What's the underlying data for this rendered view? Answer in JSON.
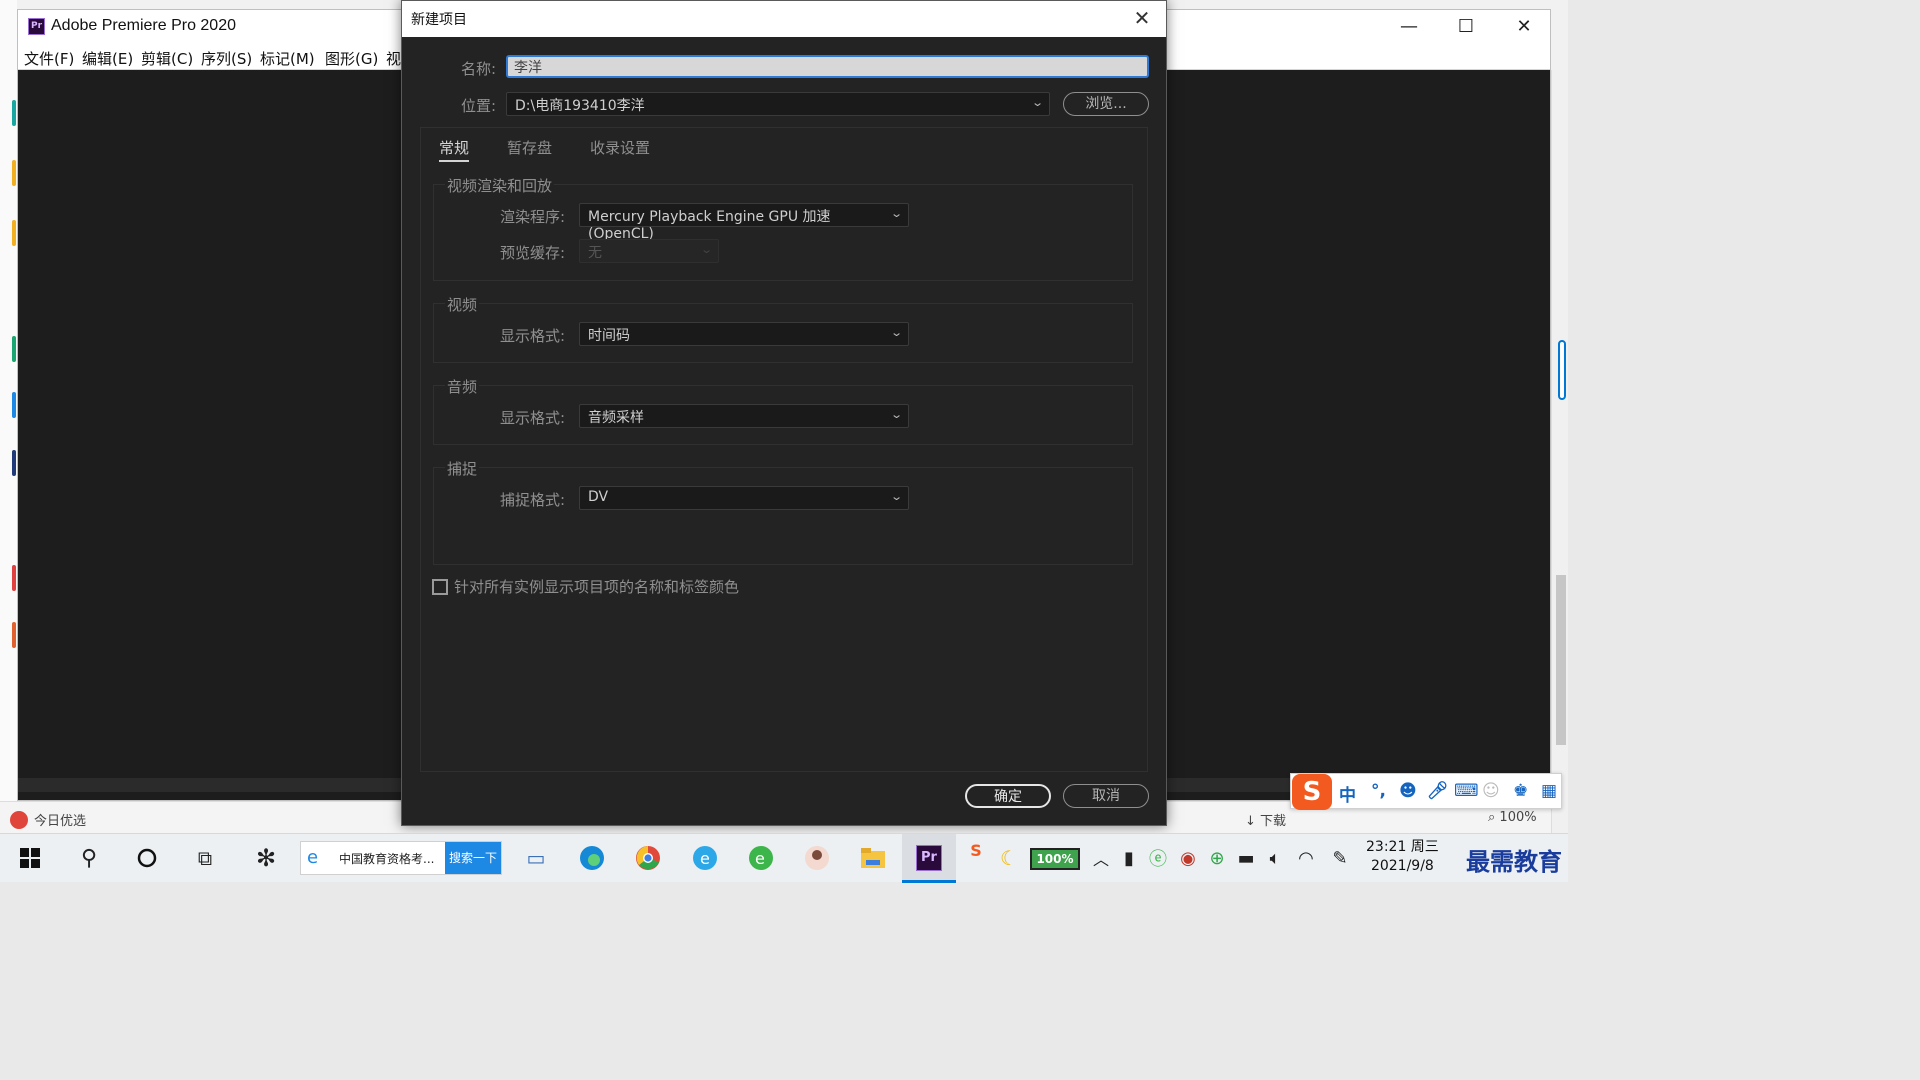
{
  "premiere": {
    "title": "Adobe Premiere Pro 2020",
    "icon_text": "Pr",
    "menu": [
      "文件(F)",
      "编辑(E)",
      "剪辑(C)",
      "序列(S)",
      "标记(M)",
      "图形(G)",
      "视"
    ],
    "controls": {
      "minimize": "—",
      "maximize": "☐",
      "close": "✕"
    }
  },
  "dialog": {
    "title": "新建项目",
    "close": "✕",
    "name_label": "名称:",
    "name_value": "李洋",
    "location_label": "位置:",
    "location_value": "D:\\电商193410李洋",
    "browse": "浏览...",
    "tabs": [
      "常规",
      "暂存盘",
      "收录设置"
    ],
    "active_tab": "常规",
    "groups": {
      "render": {
        "title": "视频渲染和回放",
        "renderer_label": "渲染程序:",
        "renderer_value": "Mercury Playback Engine GPU 加速 (OpenCL)",
        "preview_cache_label": "预览缓存:",
        "preview_cache_value": "无"
      },
      "video": {
        "title": "视频",
        "format_label": "显示格式:",
        "format_value": "时间码"
      },
      "audio": {
        "title": "音频",
        "format_label": "显示格式:",
        "format_value": "音频采样"
      },
      "capture": {
        "title": "捕捉",
        "format_label": "捕捉格式:",
        "format_value": "DV"
      }
    },
    "checkbox_label": "针对所有实例显示项目项的名称和标签颜色",
    "ok": "确定",
    "cancel": "取消"
  },
  "browser_bg": {
    "bottom_left": "今日优选",
    "download": "下载",
    "zoom": "100%"
  },
  "taskbar": {
    "search_text": "中国教育资格考...",
    "search_button": "搜索一下",
    "battery": "100%",
    "time": "23:21 周三",
    "date": "2021/9/8",
    "watermark": "最需教育"
  },
  "ime": {
    "logo": "S",
    "lang": "中",
    "punct": "°,"
  },
  "colors": {
    "accent_blue": "#2e7ad6",
    "dialog_bg": "#232323",
    "premiere_purple": "#2a0a3a",
    "sogou_orange": "#f35a1f"
  }
}
